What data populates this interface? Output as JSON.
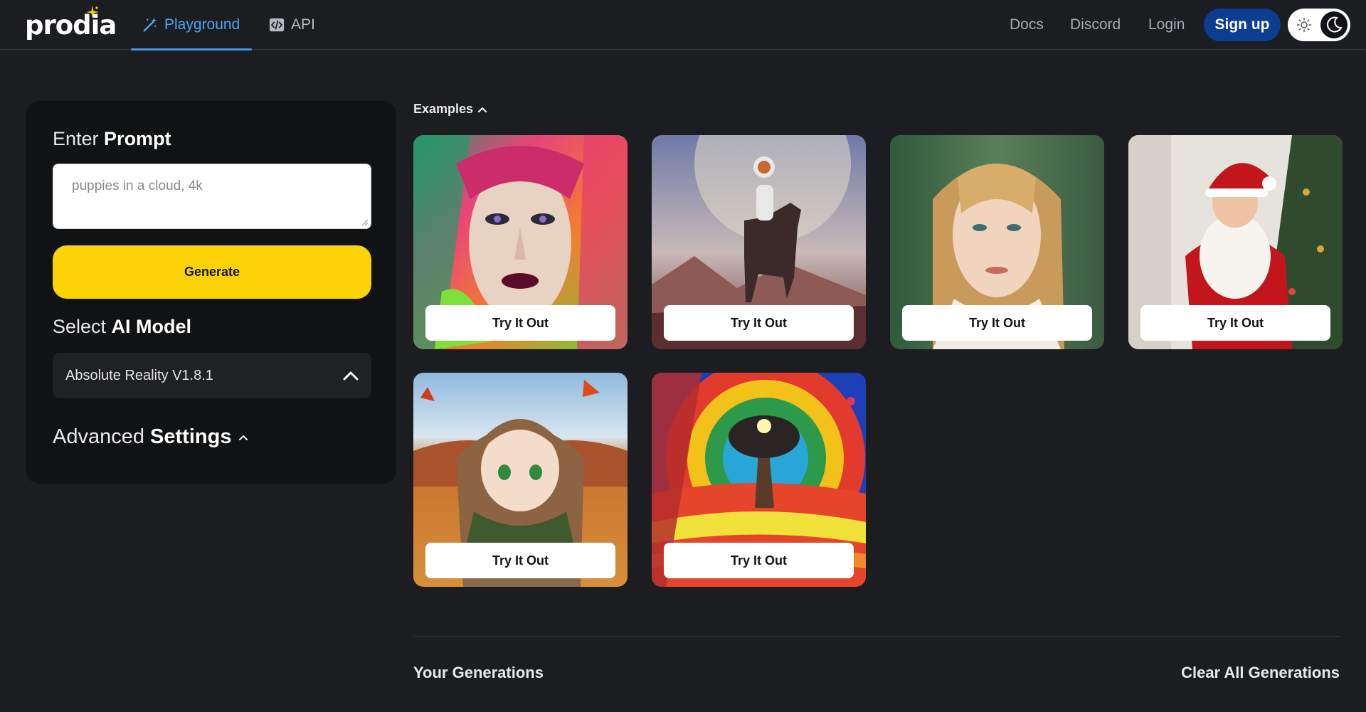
{
  "header": {
    "logo": "prodia",
    "tabs": [
      {
        "label": "Playground",
        "icon": "magic-wand-icon",
        "active": true
      },
      {
        "label": "API",
        "icon": "code-icon",
        "active": false
      }
    ],
    "links": {
      "docs": "Docs",
      "discord": "Discord",
      "login": "Login"
    },
    "signup": "Sign up",
    "theme_toggle": {
      "icons": [
        "sun-icon",
        "moon-icon"
      ],
      "mode": "dark"
    }
  },
  "sidebar": {
    "prompt_heading_light": "Enter ",
    "prompt_heading_bold": "Prompt",
    "prompt_placeholder": "puppies in a cloud, 4k",
    "generate": "Generate",
    "model_heading_light": "Select ",
    "model_heading_bold": "AI Model",
    "model_selected": "Absolute Reality V1.8.1",
    "advanced_light": "Advanced ",
    "advanced_bold": "Settings"
  },
  "examples": {
    "label": "Examples",
    "try_label": "Try It Out",
    "cards": [
      {
        "subject": "colorful abstract woman portrait"
      },
      {
        "subject": "astronaut riding a horse"
      },
      {
        "subject": "blonde woman portrait"
      },
      {
        "subject": "santa claus seated by christmas tree"
      },
      {
        "subject": "anime girl with green scarf in autumn"
      },
      {
        "subject": "psychedelic tree landscape"
      }
    ]
  },
  "generations": {
    "title": "Your Generations",
    "clear": "Clear All Generations"
  },
  "colors": {
    "background": "#1c1d20",
    "accent_blue": "#4ba6f2",
    "signup_blue": "#0b3d91",
    "generate_yellow": "#fcd306"
  }
}
